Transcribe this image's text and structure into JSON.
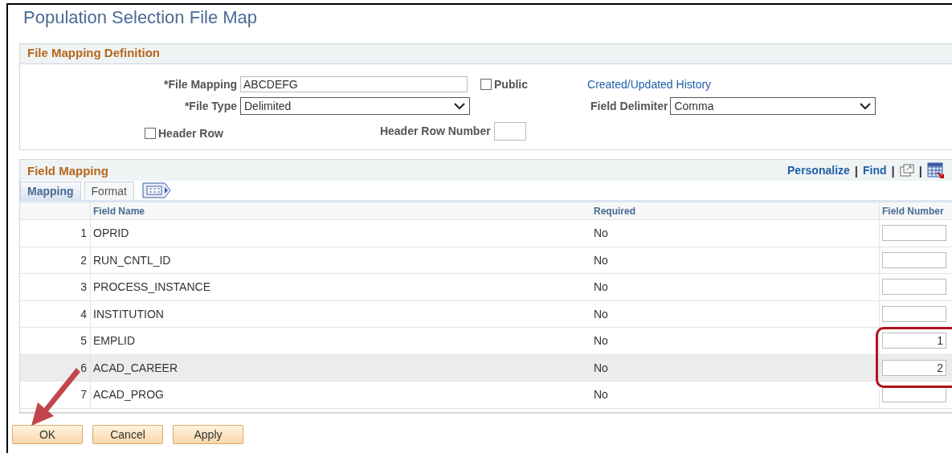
{
  "page_title": "Population Selection File Map",
  "definition": {
    "title": "File Mapping Definition",
    "file_mapping": {
      "label": "*File Mapping",
      "value": "ABCDEFG"
    },
    "public": {
      "label": "Public",
      "checked": false
    },
    "history_link": "Created/Updated History",
    "file_type": {
      "label": "*File Type",
      "value": "Delimited"
    },
    "field_delimiter": {
      "label": "Field Delimiter",
      "value": "Comma"
    },
    "header_row": {
      "label": "Header Row",
      "checked": false
    },
    "header_row_number": {
      "label": "Header Row Number"
    }
  },
  "field_mapping": {
    "title": "Field Mapping",
    "links": [
      "Personalize",
      "Find"
    ],
    "separator": "|",
    "tabs": [
      {
        "label": "Mapping",
        "selected": true
      },
      {
        "label": "Format",
        "selected": false
      }
    ],
    "columns": [
      "Field Name",
      "Required",
      "Field Number"
    ],
    "rows": [
      {
        "num": "1",
        "field": "OPRID",
        "required": "No",
        "selected": false
      },
      {
        "num": "2",
        "field": "RUN_CNTL_ID",
        "required": "No",
        "selected": false
      },
      {
        "num": "3",
        "field": "PROCESS_INSTANCE",
        "required": "No",
        "selected": false
      },
      {
        "num": "4",
        "field": "INSTITUTION",
        "required": "No",
        "selected": false
      },
      {
        "num": "5",
        "field": "EMPLID",
        "required": "No",
        "field_number": "1",
        "selected": false
      },
      {
        "num": "6",
        "field": "ACAD_CAREER",
        "required": "No",
        "field_number": "2",
        "selected": true
      },
      {
        "num": "7",
        "field": "ACAD_PROG",
        "required": "No",
        "selected": false
      }
    ]
  },
  "buttons": [
    "OK",
    "Cancel",
    "Apply"
  ]
}
